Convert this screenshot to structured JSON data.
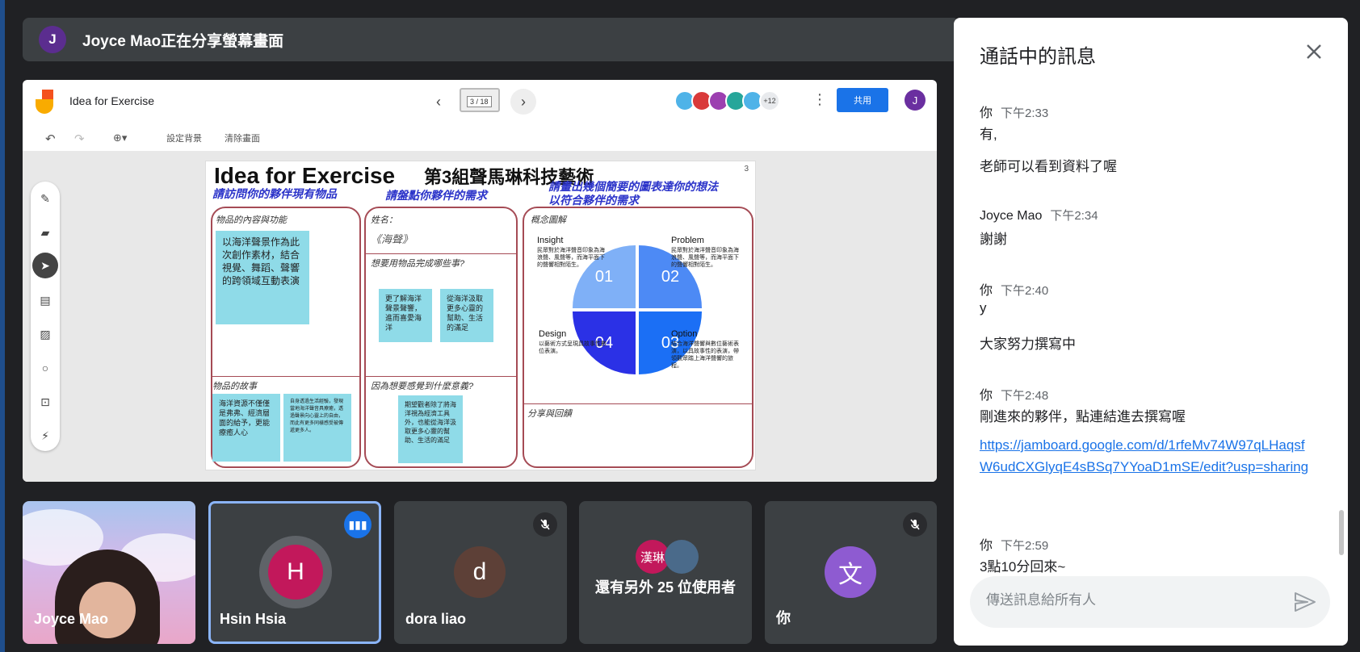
{
  "banner": {
    "avatar_letter": "J",
    "text": "Joyce Mao正在分享螢幕畫面"
  },
  "jamboard": {
    "title": "Idea for Exercise",
    "frame_counter": "3 / 18",
    "viewers_more": "+12",
    "share_label": "共用",
    "avatar_letter": "J",
    "tool_set_bg": "設定背景",
    "tool_clear": "清除畫面"
  },
  "slide": {
    "title": "Idea for Exercise",
    "group": "第3組聲馬琳科技藝術",
    "number": "3",
    "head1": "請訪問你的夥伴現有物品",
    "head2": "請盤點你夥伴的需求",
    "head3a": "請畫出幾個簡要的圖表達你的想法",
    "head3b": "以符合夥伴的需求",
    "sub_item": "物品的內容與功能",
    "sub_story": "物品的故事",
    "sub_name": "姓名：",
    "name_value": "《海聲》",
    "sub_want": "想要用物品完成哪些事?",
    "sub_why": "因為想要感覺到什麼意義?",
    "sub_concept": "概念圖解",
    "sub_share": "分享與回饋",
    "note_main": "以海洋聲景作為此次創作素材，結合視覺、舞蹈、聲響的跨領域互動表演",
    "note_story1": "海洋資源不僅僅是弗弗、經濟層面的給予，更能療癒人心",
    "note_story2": "自身透過生活經驗，發現當地海洋聲音具療癒，透過聲景向心靈上的自由，而此有更多同樣感受被傳遞更多人。",
    "note_want1": "更了解海洋聲景聲響，進而喜愛海洋",
    "note_want2": "從海洋汲取更多心靈的幫助、生活的滿足",
    "note_why": "期望觀者除了將海洋視為經濟工具外，也能從海洋汲取更多心靈的幫助、生活的滿足",
    "q1": "01",
    "q2": "02",
    "q3": "03",
    "q4": "04",
    "insight": "Insight",
    "insight_text": "民眾對於海洋聲音印象為海浪聲、風聲等，而海平面下的聲響相對陌生。",
    "problem": "Problem",
    "problem_text": "民眾對於海洋聲音印象為海浪聲、風聲等，而海平面下的聲響相對陌生。",
    "design": "Design",
    "design_text": "以藝術方式呈現具故事性數位表演。",
    "option": "Option",
    "option_text": "結合海洋聲響與數位藝術表演，以具故事性的表演，帶領觀眾踏上海洋聲響的旅程。"
  },
  "tiles": [
    {
      "name": "Joyce Mao"
    },
    {
      "name": "Hsin Hsia",
      "letter": "H",
      "color": "#c2185b"
    },
    {
      "name": "dora liao",
      "letter": "d",
      "color": "#5d4037"
    },
    {
      "name": "還有另外 25 位使用者",
      "chip": "漢琳"
    },
    {
      "name": "你",
      "letter": "文",
      "color": "#8e5bd1"
    }
  ],
  "chat": {
    "title": "通話中的訊息",
    "messages": [
      {
        "sender": "你",
        "time": "下午2:33",
        "lines": [
          "有,",
          "老師可以看到資料了喔"
        ]
      },
      {
        "sender": "Joyce Mao",
        "time": "下午2:34",
        "lines": [
          "謝謝"
        ]
      },
      {
        "sender": "你",
        "time": "下午2:40",
        "lines": [
          "y",
          "大家努力撰寫中"
        ]
      },
      {
        "sender": "你",
        "time": "下午2:48",
        "lines": [
          "剛進來的夥伴，點連結進去撰寫喔"
        ],
        "link": "https://jamboard.google.com/d/1rfeMv74W97qLHaqsfW6udCXGlyqE4sBSq7YYoaD1mSE/edit?usp=sharing"
      },
      {
        "sender": "你",
        "time": "下午2:59",
        "lines": [
          "3點10分回來~"
        ]
      }
    ],
    "input_placeholder": "傳送訊息給所有人"
  },
  "icons": {
    "close": "close-icon",
    "send": "send-icon",
    "mic_off": "mic-off-icon",
    "speaking": "audio-level-icon"
  },
  "colors": {
    "accent": "#1a73e8",
    "background": "#202124",
    "tile": "#3c4043"
  }
}
